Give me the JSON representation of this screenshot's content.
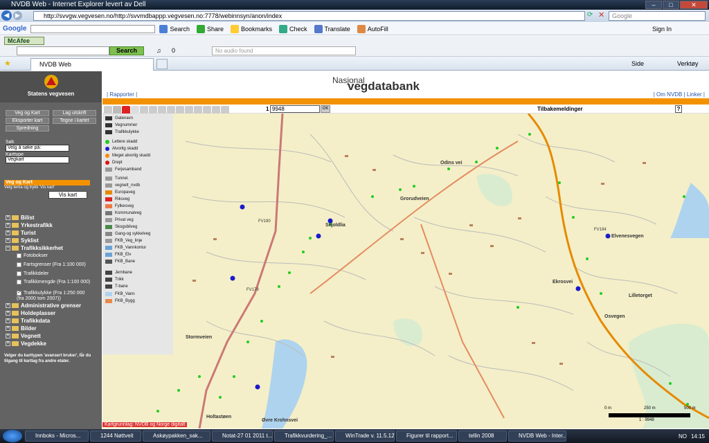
{
  "window": {
    "title": "NVDB Web - Internet Explorer levert av Dell"
  },
  "browser": {
    "address": "http://svvgw.vegvesen.no/http://svvmdbappp.vegvesen.no:7778/webinnsyn/anon/index",
    "search_placeholder": "Google",
    "google_label": "Google",
    "google_toolbar": [
      "Search",
      "Share",
      "Bookmarks",
      "Check",
      "Translate",
      "AutoFill"
    ],
    "signin": "Sign In",
    "mcafee": "McAfee",
    "search_button": "Search",
    "audio_count": "0",
    "audio_text": "No audio found",
    "tab_title": "NVDB Web",
    "page_menu": "Side",
    "tools_menu": "Verktøy"
  },
  "sidebar": {
    "org_name": "Statens vegvesen",
    "buttons": [
      "Veg og Kart",
      "Lag utskrift",
      "Eksporter kart",
      "Tegne i kartet",
      "Spredning"
    ],
    "sok_label": "Søk",
    "sok_value": "Velg å søke på:",
    "karttype_label": "Karttype",
    "karttype_value": "Vegkart",
    "section_title": "Veg og Kart",
    "section_hint": "Velg tema og trykk 'Vis kart'",
    "vis_kart": "Vis kart",
    "tree": [
      "Bilist",
      "Yrkestrafikk",
      "Turist",
      "Syklist",
      "Trafikksikkerhet"
    ],
    "sub_items": [
      "Fotobokser",
      "Fartsgrenser (Fra 1:100 000)",
      "Trafikkdeler",
      "Trafikkmengde (Fra 1:100 000)",
      "Trafikkulykke (Fra 1:250 000 (fra 2000 tom 2007))"
    ],
    "tree2": [
      "Administrative grenser",
      "Holdeplasser",
      "Trafikkdata",
      "Bilder",
      "Vegnett",
      "Vegdekke"
    ],
    "footer": "Velger du karttypen 'avansert bruker', får du tilgang til kartlag fra andre etater."
  },
  "header": {
    "title1": "Nasjonal",
    "title2": "vegdatabank",
    "left_link": "| Rapporter |",
    "right_links": "| Om NVDB | Linker |"
  },
  "map": {
    "scale_label": "1 :",
    "scale_value": "9948",
    "ok": "OK",
    "feedback": "Tilbakemeldinger",
    "help": "?",
    "credit": "Kartgrunnlag: NVDB og Norge digitalt",
    "scalebar": [
      "0 m",
      "250 m",
      "500 m"
    ],
    "scalebar_ratio": "1 : 9948",
    "road_labels": [
      "Skjoldlia",
      "Grorudveien",
      "Odins vei",
      "Elvenesvegen",
      "Ekrosvei",
      "Lilletorget",
      "Øvre Krohnsvei",
      "Holtastøen",
      "Stormveien",
      "FV190",
      "FV194",
      "FV179",
      "Osvegen"
    ],
    "legend": [
      {
        "label": "Gatenavn",
        "color": "#333"
      },
      {
        "label": "Vegnummer",
        "color": "#333"
      },
      {
        "label": "Trafikkulykke",
        "color": "#333"
      },
      {
        "label": "Lettere skadd",
        "color": "#22cc22"
      },
      {
        "label": "Alvorlig skadd",
        "color": "#1a1acc"
      },
      {
        "label": "Meget alvorlig skadd",
        "color": "#ff8800"
      },
      {
        "label": "Drept",
        "color": "#dd1111"
      },
      {
        "label": "Ferjesamband",
        "color": "#999"
      },
      {
        "label": "Tunnel.",
        "color": "#999"
      },
      {
        "label": "vegnett_nvdb",
        "color": "#999"
      },
      {
        "label": "Europaveg",
        "color": "#e58a00"
      },
      {
        "label": "Riksveg",
        "color": "#dd2222"
      },
      {
        "label": "Fylkesveg",
        "color": "#ee7744"
      },
      {
        "label": "Kommunalveg",
        "color": "#777"
      },
      {
        "label": "Privat veg",
        "color": "#999"
      },
      {
        "label": "Skogsbilveg",
        "color": "#4a8a4a"
      },
      {
        "label": "Gang-og sykkelveg",
        "color": "#888"
      },
      {
        "label": "FKB_Veg_linje",
        "color": "#999"
      },
      {
        "label": "FKB_Vannkontur",
        "color": "#6aa3d6"
      },
      {
        "label": "FKB_Elv",
        "color": "#6aa3d6"
      },
      {
        "label": "FKB_Bane",
        "color": "#555"
      },
      {
        "label": "Jernbane",
        "color": "#444"
      },
      {
        "label": "Trikk",
        "color": "#444"
      },
      {
        "label": "T-bane",
        "color": "#444"
      },
      {
        "label": "FKB_Vann",
        "color": "#aed3ee"
      },
      {
        "label": "FKB_Bygg",
        "color": "#e8894a"
      }
    ]
  },
  "taskbar": {
    "items": [
      "Innboks - Micros...",
      "1244 Nøttveit",
      "Askøypakken_sak...",
      "Notat-27 01 2011 t...",
      "Trafikkvurdering_...",
      "WinTrade v. 11.5.12",
      "Figurer til rapport...",
      "tellin 2008",
      "NVDB Web - Inter..."
    ],
    "lang": "NO",
    "clock": "14:15"
  }
}
